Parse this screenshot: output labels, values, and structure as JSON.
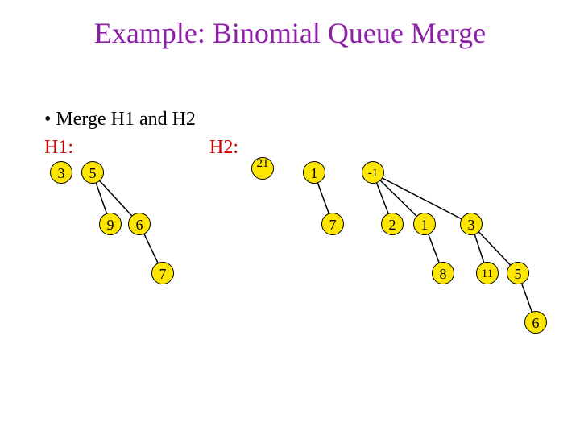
{
  "title": "Example: Binomial Queue Merge",
  "bullet": "Merge H1 and H2",
  "labels": {
    "h1": "H1:",
    "h2": "H2:"
  },
  "h1": {
    "b0": {
      "root": "3"
    },
    "b2": {
      "root": "5",
      "c1": "9",
      "c2": "6",
      "c2c": "7"
    }
  },
  "h2": {
    "b0": {
      "root": "21"
    },
    "b1": {
      "root": "1",
      "c1": "7"
    },
    "b3": {
      "root": "-1",
      "a": "2",
      "b": "1",
      "c": "3",
      "b1": "8",
      "c1": "11",
      "c2": "5",
      "c2a": "6"
    }
  },
  "chart_data": {
    "type": "tree",
    "description": "Two binomial queues H1 and H2 before merging",
    "H1": [
      {
        "order": 0,
        "nodes": [
          3
        ]
      },
      {
        "order": 2,
        "structure": {
          "5": {
            "9": {},
            "6": {
              "7": {}
            }
          }
        }
      }
    ],
    "H2": [
      {
        "order": 0,
        "nodes": [
          21
        ]
      },
      {
        "order": 1,
        "structure": {
          "1": {
            "7": {}
          }
        }
      },
      {
        "order": 3,
        "structure": {
          "-1": {
            "2": {},
            "1": {
              "8": {}
            },
            "3": {
              "11": {},
              "5": {
                "6": {}
              }
            }
          }
        }
      }
    ]
  }
}
